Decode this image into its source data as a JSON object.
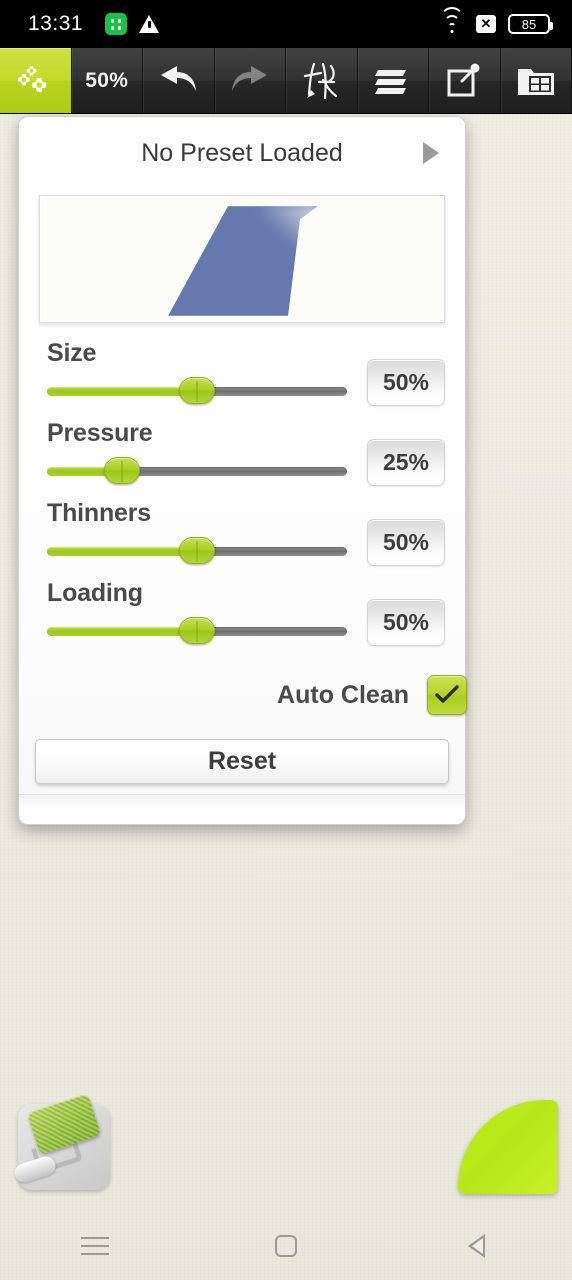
{
  "status_bar": {
    "time": "13:31",
    "app_icon": "app-badge-icon",
    "warning_icon": "warning-triangle-icon",
    "wifi_icon": "wifi-icon",
    "x_icon": "x-close-icon",
    "battery_level": "85"
  },
  "toolbar": {
    "buttons": [
      {
        "name": "settings-gears",
        "label": "",
        "icon": "gears-icon",
        "active": true
      },
      {
        "name": "zoom-level",
        "label": "50%",
        "icon": "",
        "active": false
      },
      {
        "name": "undo",
        "label": "",
        "icon": "undo-arrow-icon",
        "active": false
      },
      {
        "name": "redo",
        "label": "",
        "icon": "redo-arrow-icon",
        "active": false
      },
      {
        "name": "brushes",
        "label": "",
        "icon": "brushes-icon",
        "active": false
      },
      {
        "name": "layers",
        "label": "",
        "icon": "layers-icon",
        "active": false
      },
      {
        "name": "share",
        "label": "",
        "icon": "share-export-icon",
        "active": false
      },
      {
        "name": "gallery",
        "label": "",
        "icon": "gallery-folder-icon",
        "active": false
      }
    ],
    "zoom_label": "50%"
  },
  "panel": {
    "preset_label": "No Preset Loaded",
    "preset_arrow_icon": "triangle-right-icon",
    "preview_name": "brush-stroke-preview",
    "sliders": [
      {
        "label": "Size",
        "value": "50%",
        "percent": 50
      },
      {
        "label": "Pressure",
        "value": "25%",
        "percent": 25
      },
      {
        "label": "Thinners",
        "value": "50%",
        "percent": 50
      },
      {
        "label": "Loading",
        "value": "50%",
        "percent": 50
      }
    ],
    "auto_clean": {
      "label": "Auto Clean",
      "checked": true,
      "check_icon": "checkmark-icon"
    },
    "reset_label": "Reset"
  },
  "canvas": {
    "tool_icon": "paint-roller-icon",
    "color_swatch": "current-color-swatch"
  },
  "nav_bar": {
    "menu_icon": "menu-recents-icon",
    "home_icon": "home-square-icon",
    "back_icon": "back-triangle-icon"
  },
  "colors": {
    "accent_green": "#b4d52c",
    "swatch_green": "#bfeb19",
    "toolbar_dark": "#2b2b2b",
    "stroke_blue": "#6679ae",
    "canvas_bg": "#efeee4"
  }
}
